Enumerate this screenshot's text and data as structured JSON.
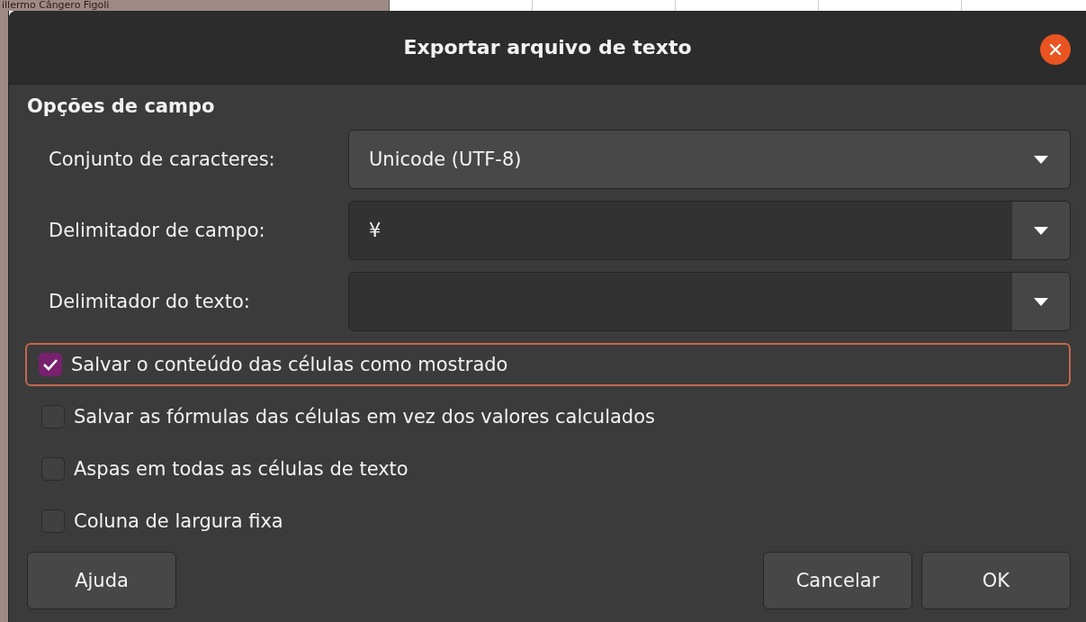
{
  "background_sheet": {
    "cell_text": "illermo Cângero Figoli"
  },
  "dialog": {
    "title": "Exportar arquivo de texto",
    "section_title": "Opções de campo",
    "fields": [
      {
        "kind": "combo",
        "label": "Conjunto de caracteres:",
        "value": "Unicode (UTF-8)"
      },
      {
        "kind": "editable",
        "label": "Delimitador de campo:",
        "value": "¥"
      },
      {
        "kind": "editable",
        "label": "Delimitador do texto:"
      }
    ],
    "options": [
      {
        "label": "Salvar o conteúdo das células como mostrado",
        "checked": true,
        "focused": true
      },
      {
        "label": "Salvar as fórmulas das células em vez dos valores calculados",
        "checked": false,
        "focused": false
      },
      {
        "label": "Aspas em todas as células de texto",
        "checked": false,
        "focused": false
      },
      {
        "label": "Coluna de largura fixa",
        "checked": false,
        "focused": false
      }
    ],
    "buttons": {
      "help": "Ajuda",
      "cancel": "Cancelar",
      "ok": "OK"
    }
  }
}
